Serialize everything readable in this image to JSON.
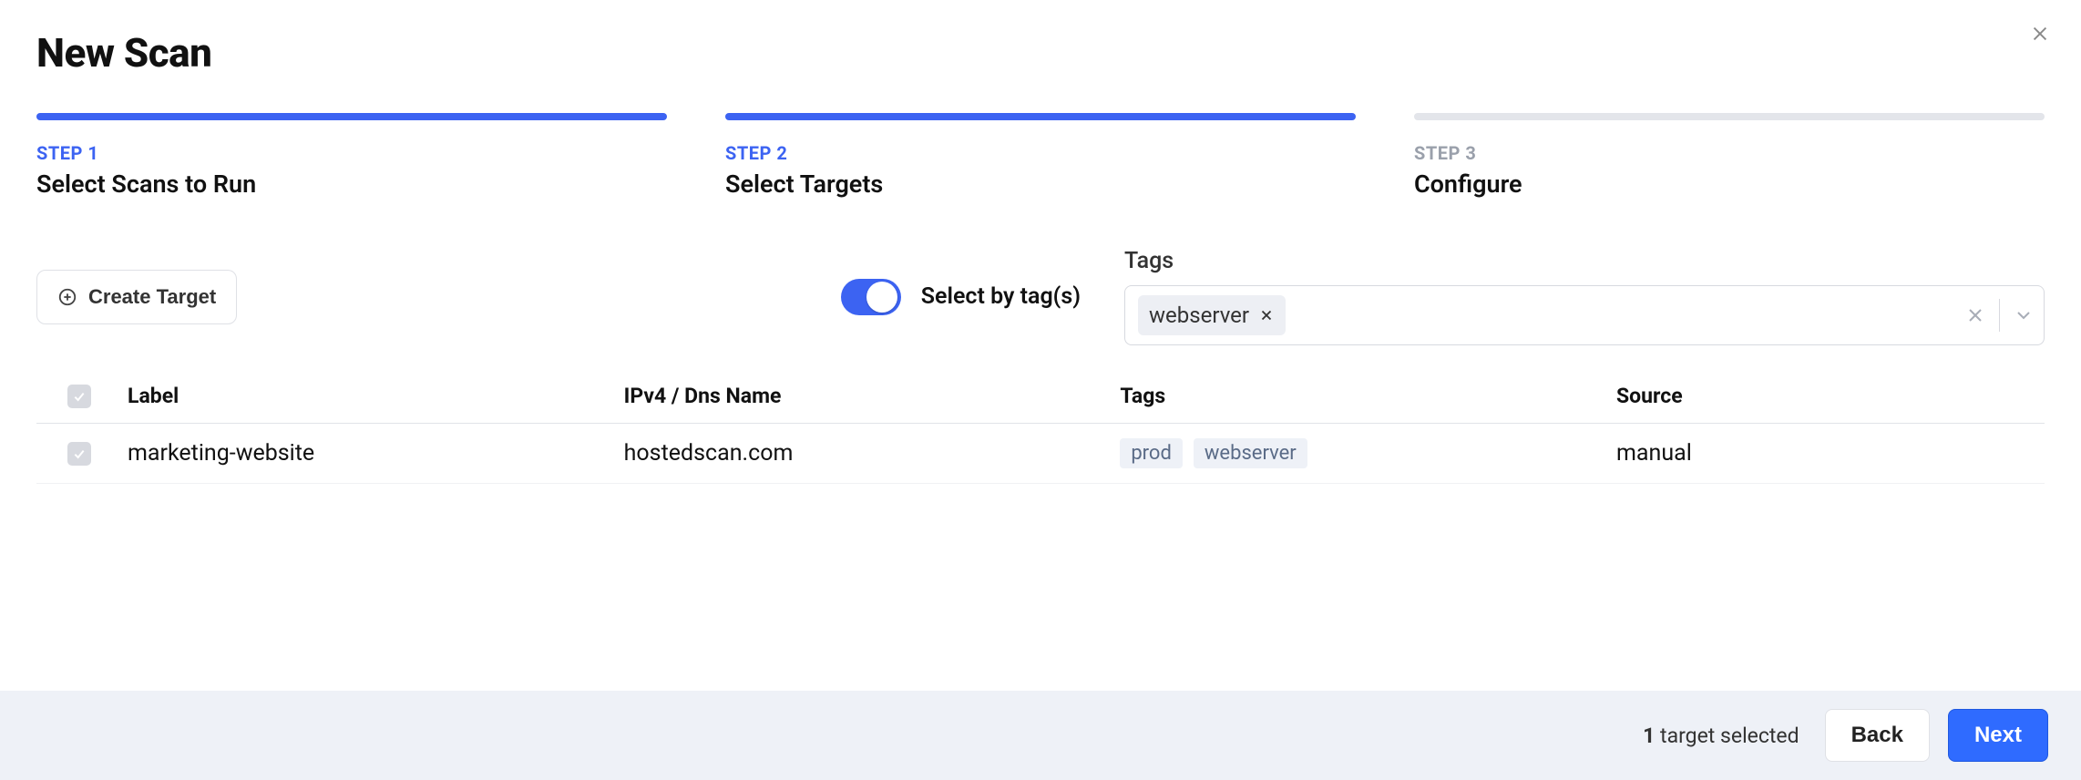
{
  "header": {
    "title": "New Scan"
  },
  "steps": [
    {
      "num": "STEP 1",
      "label": "Select Scans to Run",
      "active": true
    },
    {
      "num": "STEP 2",
      "label": "Select Targets",
      "active": true
    },
    {
      "num": "STEP 3",
      "label": "Configure",
      "active": false
    }
  ],
  "controls": {
    "create_label": "Create Target",
    "toggle_label": "Select by tag(s)",
    "tags_label": "Tags",
    "selected_tags": [
      "webserver"
    ]
  },
  "table": {
    "headers": {
      "label": "Label",
      "host": "IPv4 / Dns Name",
      "tags": "Tags",
      "source": "Source"
    },
    "rows": [
      {
        "label": "marketing-website",
        "host": "hostedscan.com",
        "tags": [
          "prod",
          "webserver"
        ],
        "source": "manual"
      }
    ]
  },
  "footer": {
    "count": "1",
    "status_suffix": " target selected",
    "back": "Back",
    "next": "Next"
  }
}
